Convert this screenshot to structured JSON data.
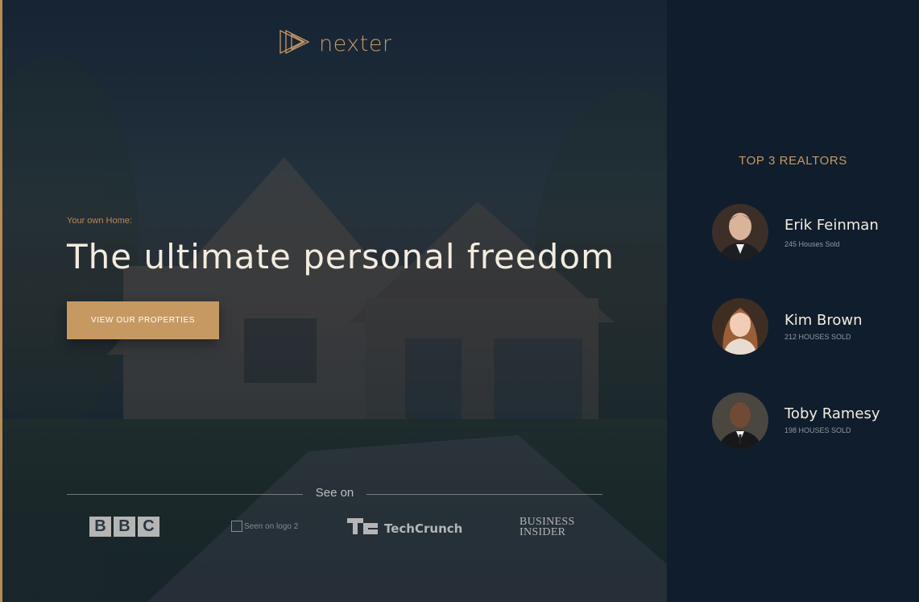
{
  "brand": {
    "name": "nexter",
    "logo_icon": "play-triangles-icon",
    "accent_color": "#c69963",
    "dark_color": "#101d2c"
  },
  "hero": {
    "eyebrow": "Your own Home:",
    "headline": "The ultimate personal freedom",
    "cta_label": "VIEW OUR PROPERTIES"
  },
  "seen_on": {
    "label": "See on",
    "logos": [
      {
        "name": "BBC",
        "letters": [
          "B",
          "B",
          "C"
        ]
      },
      {
        "name": "broken-image",
        "alt_text": "Seen on logo 2"
      },
      {
        "name": "TechCrunch",
        "text": "TechCrunch"
      },
      {
        "name": "Business Insider",
        "line1": "BUSINESS",
        "line2": "INSIDER"
      }
    ]
  },
  "sidebar": {
    "title": "TOP 3 REALTORS",
    "realtors": [
      {
        "name": "Erik Feinman",
        "sold": "245 Houses Sold"
      },
      {
        "name": "Kim Brown",
        "sold": "212 HOUSES SOLD"
      },
      {
        "name": "Toby Ramesy",
        "sold": "198 HOUSES SOLD"
      }
    ]
  }
}
